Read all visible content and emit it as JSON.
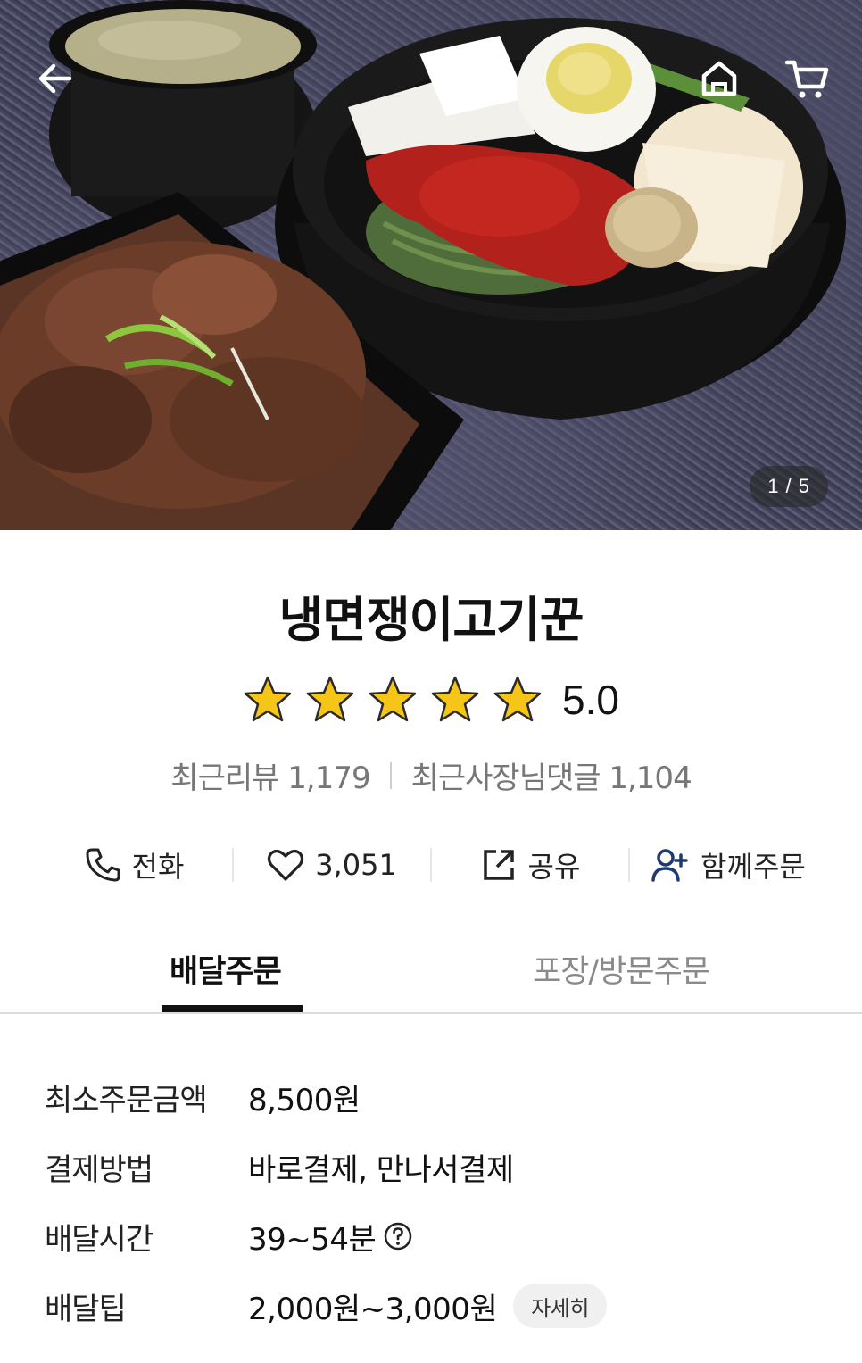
{
  "hero": {
    "page_indicator": "1 / 5",
    "icons": {
      "back": "back-arrow-icon",
      "home": "home-icon",
      "cart": "cart-icon"
    }
  },
  "store": {
    "name": "냉면쟁이고기꾼",
    "rating": "5.0",
    "stars": 5,
    "recent_reviews_label": "최근리뷰",
    "recent_reviews_count": "1,179",
    "owner_replies_label": "최근사장님댓글",
    "owner_replies_count": "1,104"
  },
  "actions": {
    "call_label": "전화",
    "like_count": "3,051",
    "share_label": "공유",
    "group_order_label": "함께주문"
  },
  "tabs": {
    "delivery": "배달주문",
    "pickup": "포장/방문주문",
    "active": "delivery"
  },
  "info": {
    "min_order": {
      "label": "최소주문금액",
      "value": "8,500원"
    },
    "payment": {
      "label": "결제방법",
      "value": "바로결제, 만나서결제"
    },
    "delivery_time": {
      "label": "배달시간",
      "value": "39~54분"
    },
    "delivery_tip": {
      "label": "배달팁",
      "value": "2,000원~3,000원",
      "detail_button": "자세히"
    }
  },
  "colors": {
    "star": "#F5C518",
    "accent_icon": "#1F3A6E",
    "text_primary": "#111111",
    "text_secondary": "#777777"
  }
}
